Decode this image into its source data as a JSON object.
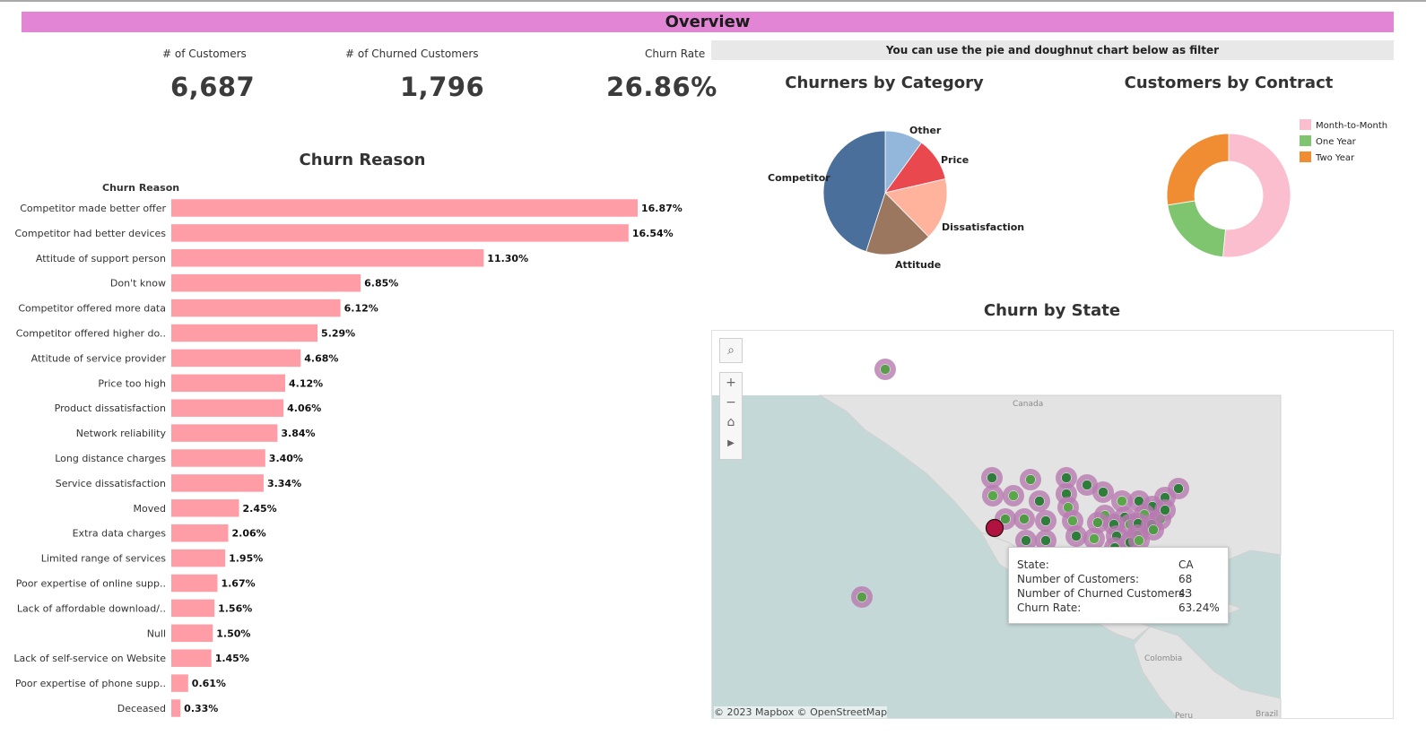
{
  "banner": {
    "title": "Overview"
  },
  "kpis": [
    {
      "label": "# of Customers",
      "value": "6,687"
    },
    {
      "label": "# of Churned Customers",
      "value": "1,796"
    },
    {
      "label": "Churn Rate",
      "value": "26.86%"
    }
  ],
  "filter_note": "You can use the pie and doughnut chart below as filter",
  "churn_reason": {
    "title": "Churn Reason",
    "column_header": "Churn Reason"
  },
  "churners_by_category": {
    "title": "Churners by Category"
  },
  "customers_by_contract": {
    "title": "Customers by Contract"
  },
  "churn_by_state": {
    "title": "Churn by State",
    "map_labels": {
      "canada": "Canada",
      "colombia": "Colombia",
      "peru": "Peru",
      "brazil": "Brazil"
    },
    "attribution": "© 2023 Mapbox  © OpenStreetMap",
    "controls": [
      {
        "name": "search-icon",
        "glyph": "⌕"
      },
      {
        "name": "zoom-in-icon",
        "glyph": "+"
      },
      {
        "name": "zoom-out-icon",
        "glyph": "−"
      },
      {
        "name": "home-icon",
        "glyph": "⌂"
      },
      {
        "name": "play-icon",
        "glyph": "▶"
      }
    ],
    "tooltip": {
      "state_label": "State:",
      "state_value": "CA",
      "customers_label": "Number of Customers:",
      "customers_value": "68",
      "churned_label": "Number of Churned Customers:",
      "churned_value": "43",
      "rate_label": "Churn Rate:",
      "rate_value": "63.24%"
    }
  },
  "chart_data": [
    {
      "type": "bar",
      "orientation": "horizontal",
      "title": "Churn Reason",
      "ylabel": "Churn Reason",
      "categories": [
        "Competitor made better offer",
        "Competitor had better devices",
        "Attitude of support person",
        "Don't know",
        "Competitor offered more data",
        "Competitor offered higher do..",
        "Attitude of service provider",
        "Price too high",
        "Product dissatisfaction",
        "Network reliability",
        "Long distance charges",
        "Service dissatisfaction",
        "Moved",
        "Extra data charges",
        "Limited range of services",
        "Poor expertise of online supp..",
        "Lack of affordable download/..",
        "Null",
        "Lack of self-service on Website",
        "Poor expertise of phone supp..",
        "Deceased"
      ],
      "values": [
        16.87,
        16.54,
        11.3,
        6.85,
        6.12,
        5.29,
        4.68,
        4.12,
        4.06,
        3.84,
        3.4,
        3.34,
        2.45,
        2.06,
        1.95,
        1.67,
        1.56,
        1.5,
        1.45,
        0.61,
        0.33
      ],
      "value_labels": [
        "16.87%",
        "16.54%",
        "11.30%",
        "6.85%",
        "6.12%",
        "5.29%",
        "4.68%",
        "4.12%",
        "4.06%",
        "3.84%",
        "3.40%",
        "3.34%",
        "2.45%",
        "2.06%",
        "1.95%",
        "1.67%",
        "1.56%",
        "1.50%",
        "1.45%",
        "0.61%",
        "0.33%"
      ],
      "color": "#ff9da7"
    },
    {
      "type": "pie",
      "title": "Churners by Category",
      "slices": [
        {
          "label": "Competitor",
          "value": 45.0,
          "color": "#4a6f9b"
        },
        {
          "label": "Attitude",
          "value": 17.4,
          "color": "#9c7760"
        },
        {
          "label": "Dissatisfaction",
          "value": 16.2,
          "color": "#ffb39d"
        },
        {
          "label": "Price",
          "value": 11.4,
          "color": "#e8484e"
        },
        {
          "label": "Other",
          "value": 10.0,
          "color": "#93b6db"
        }
      ]
    },
    {
      "type": "pie",
      "subtype": "doughnut",
      "title": "Customers by Contract",
      "legend_position": "right",
      "slices": [
        {
          "label": "Month-to-Month",
          "value": 51.5,
          "color": "#fbbece"
        },
        {
          "label": "One Year",
          "value": 21.0,
          "color": "#7fc46f"
        },
        {
          "label": "Two Year",
          "value": 27.5,
          "color": "#f08c31"
        }
      ]
    }
  ]
}
